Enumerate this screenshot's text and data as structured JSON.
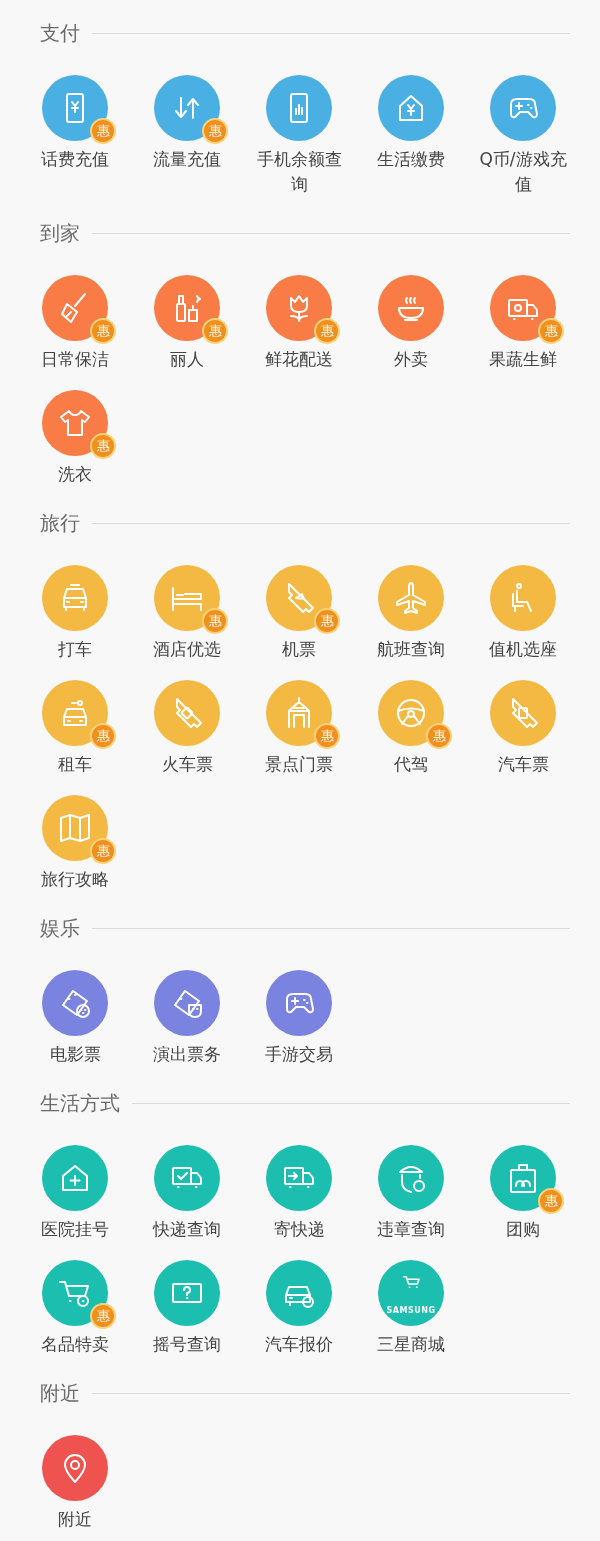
{
  "sections": [
    {
      "title": "支付",
      "color": "#4aafe3",
      "items": [
        {
          "label": "话费充值",
          "badge": "惠"
        },
        {
          "label": "流量充值",
          "badge": "惠"
        },
        {
          "label": "手机余额查询"
        },
        {
          "label": "生活缴费"
        },
        {
          "label": "Q币/游戏充值"
        }
      ]
    },
    {
      "title": "到家",
      "color": "#f97b45",
      "items": [
        {
          "label": "日常保洁",
          "badge": "惠"
        },
        {
          "label": "丽人",
          "badge": "惠"
        },
        {
          "label": "鲜花配送",
          "badge": "惠"
        },
        {
          "label": "外卖"
        },
        {
          "label": "果蔬生鲜",
          "badge": "惠"
        },
        {
          "label": "洗衣",
          "badge": "惠"
        }
      ]
    },
    {
      "title": "旅行",
      "color": "#f4b942",
      "items": [
        {
          "label": "打车"
        },
        {
          "label": "酒店优选",
          "badge": "惠"
        },
        {
          "label": "机票",
          "badge": "惠"
        },
        {
          "label": "航班查询"
        },
        {
          "label": "值机选座"
        },
        {
          "label": "租车",
          "badge": "惠"
        },
        {
          "label": "火车票"
        },
        {
          "label": "景点门票",
          "badge": "惠"
        },
        {
          "label": "代驾",
          "badge": "惠"
        },
        {
          "label": "汽车票"
        },
        {
          "label": "旅行攻略",
          "badge": "惠"
        }
      ]
    },
    {
      "title": "娱乐",
      "color": "#7b83e0",
      "items": [
        {
          "label": "电影票"
        },
        {
          "label": "演出票务"
        },
        {
          "label": "手游交易"
        }
      ]
    },
    {
      "title": "生活方式",
      "color": "#1cbfaf",
      "items": [
        {
          "label": "医院挂号"
        },
        {
          "label": "快递查询"
        },
        {
          "label": "寄快递"
        },
        {
          "label": "违章查询"
        },
        {
          "label": "团购",
          "badge": "惠"
        },
        {
          "label": "名品特卖",
          "badge": "惠"
        },
        {
          "label": "摇号查询"
        },
        {
          "label": "汽车报价"
        },
        {
          "label": "三星商城",
          "icon_text": "SAMSUNG"
        }
      ]
    },
    {
      "title": "附近",
      "color": "#ef5350",
      "items": [
        {
          "label": "附近"
        }
      ]
    }
  ]
}
